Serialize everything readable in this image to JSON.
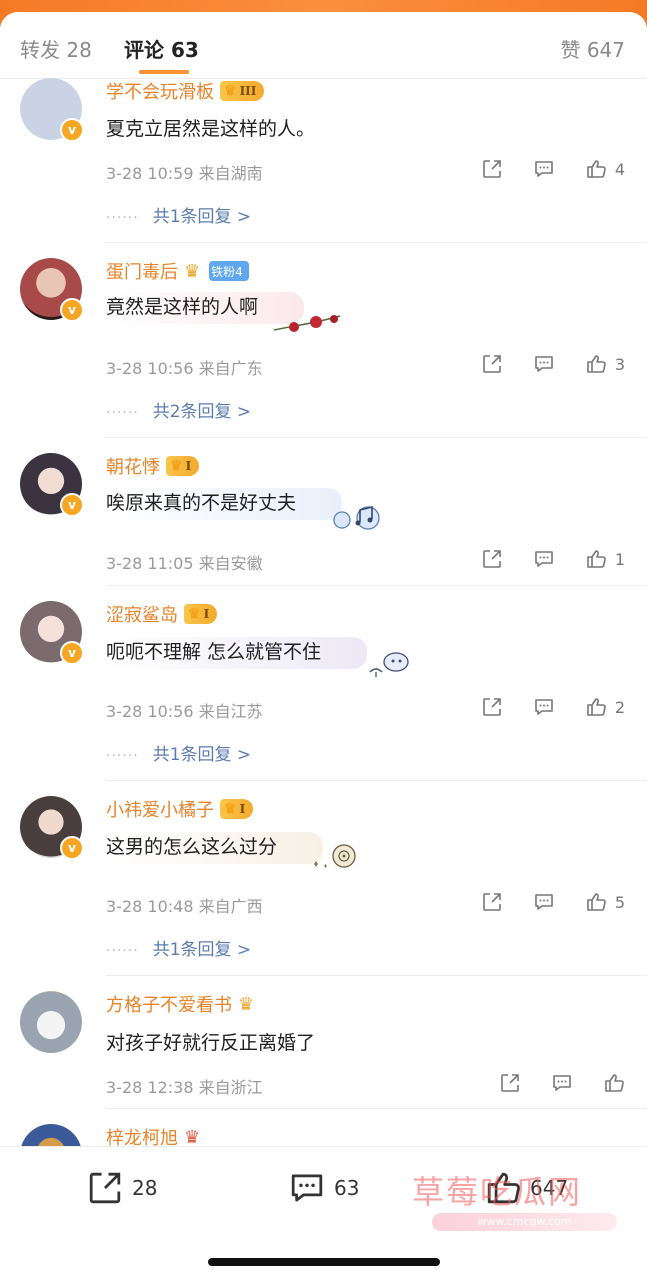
{
  "header": {
    "repost_tab": "转发 28",
    "comments_tab": "评论 63",
    "likes_tab": "赞 647"
  },
  "comments": [
    {
      "username": "学不会玩滑板",
      "level": "III",
      "text": "夏克立居然是这样的人。",
      "time_location": "3-28 10:59  来自湖南",
      "likes": "4",
      "replies": "共1条回复 >",
      "avatar_color": "#c9d3e4"
    },
    {
      "username": "蛋门毒后",
      "fan_badge": "铁粉4",
      "text": "竟然是这样的人啊",
      "time_location": "3-28 10:56  来自广东",
      "likes": "3",
      "replies": "共2条回复 >",
      "avatar_color": "#a84a4a"
    },
    {
      "username": "朝花悸",
      "level": "I",
      "text": "唉原来真的不是好丈夫",
      "time_location": "3-28 11:05  来自安徽",
      "likes": "1",
      "avatar_color": "#3b3340"
    },
    {
      "username": "涩寂鲨岛",
      "level": "I",
      "text": "呃呃不理解 怎么就管不住",
      "time_location": "3-28 10:56  来自江苏",
      "likes": "2",
      "replies": "共1条回复 >",
      "avatar_color": "#7b6a6e"
    },
    {
      "username": "小祎爱小橘子",
      "level": "I",
      "text": "这男的怎么这么过分",
      "time_location": "3-28 10:48  来自广西",
      "likes": "5",
      "replies": "共1条回复 >",
      "avatar_color": "#4a3d3d"
    },
    {
      "username": "方格子不爱看书",
      "text": "对孩子好就行反正离婚了",
      "time_location": "3-28 12:38  来自浙江",
      "avatar_color": "#9aa4b0"
    },
    {
      "username": "梓龙柯旭",
      "avatar_color": "#3b5a9a"
    }
  ],
  "bottom_bar": {
    "repost_count": "28",
    "comment_count": "63",
    "like_count": "647"
  },
  "watermark": {
    "text": "草莓吃瓜网",
    "url": "www.cmcgw.com"
  },
  "colors": {
    "accent_orange": "#f79333",
    "username_orange": "#e8832a",
    "reply_blue": "#5b7cb0"
  }
}
